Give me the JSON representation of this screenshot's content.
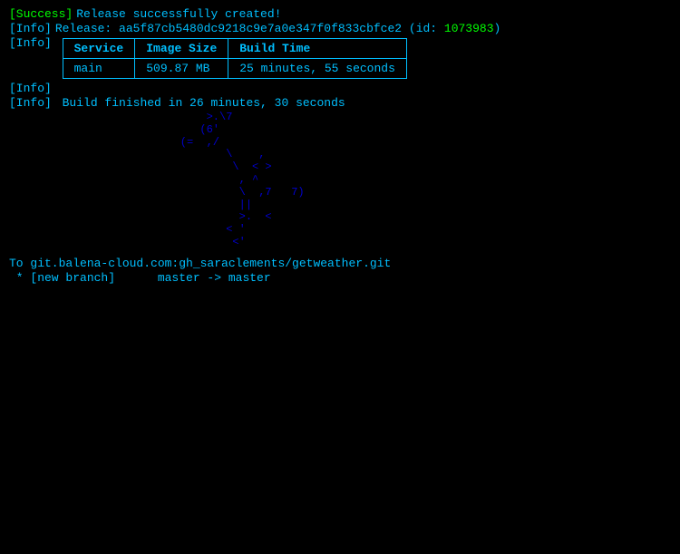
{
  "terminal": {
    "success_tag": "[Success]",
    "success_msg": "Release successfully created!",
    "info_tag": "[Info]",
    "release_label": "Release: ",
    "release_hash": "aa5f87cb5480dc9218c9e7a0e347f0f833cbfce2",
    "release_id_label": " (id: ",
    "release_id": "1073983",
    "release_id_close": ")",
    "table": {
      "headers": [
        "Service",
        "Image Size",
        "Build Time"
      ],
      "rows": [
        [
          "main",
          "509.87 MB",
          "25 minutes, 55 seconds"
        ]
      ]
    },
    "build_finished": "Build finished in 26 minutes, 30 seconds",
    "git_push_line1": "To git.balena-cloud.com:gh_saraclements/getweather.git",
    "git_push_line2": " * [new branch]      master -> master",
    "ascii_art": "        >.\\7\n       (6'\n    (=  ,/\n        \\    ,\n         \\  < >\n          , ^\n          \\  ,7   7)\n          ||\n          >.  <\n        < '\n         <'"
  }
}
